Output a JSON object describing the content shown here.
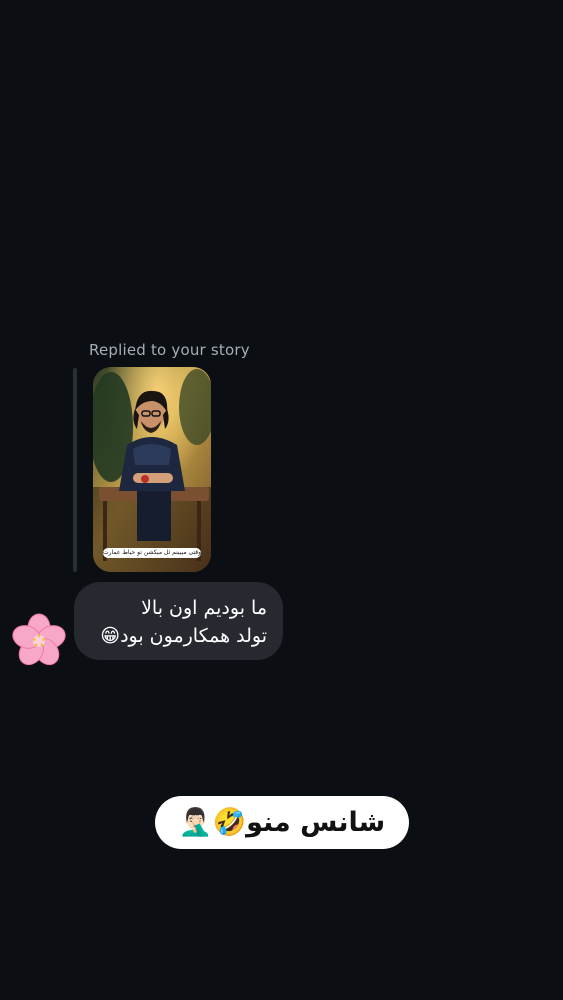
{
  "reply": {
    "label": "Replied to your story",
    "story_caption": "وقتی میبینم ئل میکشن تو حیاط عمارت 😂"
  },
  "message": {
    "line1": "ما بودیم اون بالا",
    "line2": "تولد همکارمون بود😁"
  },
  "reaction": {
    "icon": "cherry-blossom-icon"
  },
  "sticker": {
    "text": "شانس منو🤣🤦🏻‍♂️"
  },
  "colors": {
    "background": "#0b0e12",
    "bubble": "#262a30",
    "reply_label": "#a7adb6",
    "sticker_bg": "#ffffff"
  }
}
